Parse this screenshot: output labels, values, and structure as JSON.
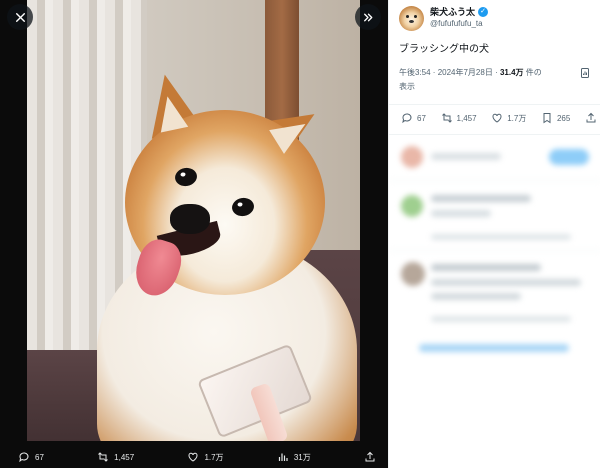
{
  "viewer": {
    "close_icon": "close-icon",
    "expand_icon": "chevron-double-right-icon",
    "actions": {
      "reply_count": "67",
      "retweet_count": "1,457",
      "like_count": "1.7万",
      "views_count": "31万"
    }
  },
  "tweet": {
    "display_name": "柴犬ふう太",
    "handle": "@fufufufufu_ta",
    "text": "ブラッシング中の犬",
    "time": "午後3:54",
    "date": "2024年7月28日",
    "views": "31.4万",
    "views_suffix": "件の",
    "views_label": "表示",
    "actions": {
      "reply_count": "67",
      "retweet_count": "1,457",
      "like_count": "1.7万",
      "bookmark_count": "265"
    }
  },
  "colors": {
    "accent": "#1d9bf0",
    "text_primary": "#0f1419",
    "text_secondary": "#536471"
  }
}
